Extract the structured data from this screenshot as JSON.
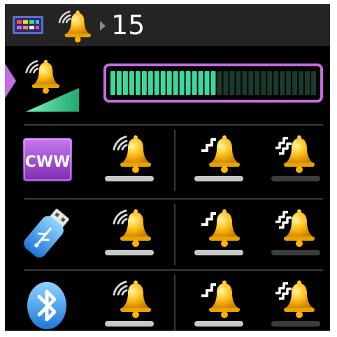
{
  "colors": {
    "topbar_bg": "#242424",
    "background": "#000000",
    "accent_purple": "#c46ce0",
    "volume_fill": "#3ed7a0",
    "volume_empty": "#1a3a2e",
    "bell_yellow": "#ffc21a",
    "indicator_on": "#c8c8c8",
    "indicator_off": "#3c3c3c"
  },
  "header": {
    "device_icon": "device-icon",
    "bell_icon": "ringing-bell-icon",
    "arrow_icon": "play-arrow-icon",
    "number": "15"
  },
  "volume": {
    "icon": "ringing-bell-volume-icon",
    "level_segments_total": 33,
    "level_segments_filled": 17
  },
  "rows": [
    {
      "source": "CWW",
      "source_icon": "cww-icon",
      "options": [
        {
          "icon": "ringing-bell-icon",
          "enabled": true
        },
        {
          "icon": "bell-step-icon",
          "enabled": true
        },
        {
          "icon": "bell-double-step-icon",
          "enabled": false
        }
      ]
    },
    {
      "source": "usb",
      "source_icon": "usb-stick-icon",
      "options": [
        {
          "icon": "ringing-bell-icon",
          "enabled": true
        },
        {
          "icon": "bell-step-icon",
          "enabled": true
        },
        {
          "icon": "bell-double-step-icon",
          "enabled": false
        }
      ]
    },
    {
      "source": "bluetooth",
      "source_icon": "bluetooth-icon",
      "options": [
        {
          "icon": "ringing-bell-icon",
          "enabled": true
        },
        {
          "icon": "bell-step-icon",
          "enabled": true
        },
        {
          "icon": "bell-double-step-icon",
          "enabled": false
        }
      ]
    }
  ]
}
